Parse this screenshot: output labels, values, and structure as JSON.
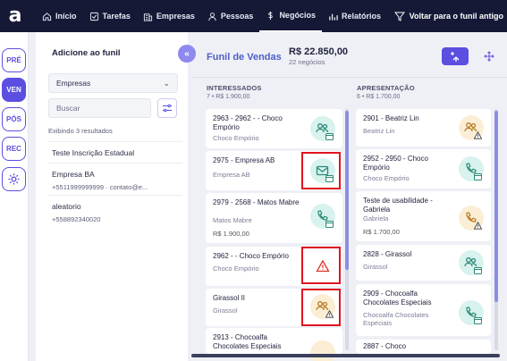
{
  "brand": {
    "logo": "a"
  },
  "nav": {
    "items": [
      {
        "label": "Início",
        "icon": "home-icon"
      },
      {
        "label": "Tarefas",
        "icon": "checkbox-icon"
      },
      {
        "label": "Empresas",
        "icon": "building-icon"
      },
      {
        "label": "Pessoas",
        "icon": "person-icon"
      },
      {
        "label": "Negócios",
        "icon": "money-icon",
        "active": true
      },
      {
        "label": "Relatórios",
        "icon": "chart-icon"
      }
    ],
    "back_label": "Voltar para o funil antigo"
  },
  "rail": {
    "items": [
      "PRÉ",
      "VEN",
      "PÓS",
      "REC"
    ],
    "active": "VEN",
    "settings_icon": "gear-icon"
  },
  "panel": {
    "title": "Adicione ao funil",
    "select_value": "Empresas",
    "search_placeholder": "Buscar",
    "results_text": "Exibindo 3 resultados",
    "entries": [
      {
        "name": "Teste Inscrição Estadual",
        "sub": ""
      },
      {
        "name": "Empresa BA",
        "sub": "+5511999999999 · contato@e..."
      },
      {
        "name": "aleatorio",
        "sub": "+558892340020"
      }
    ]
  },
  "board": {
    "title": "Funil de Vendas",
    "total": "R$ 22.850,00",
    "count": "22 negócios",
    "add_label": "+"
  },
  "columns": [
    {
      "title": "INTERESSADOS",
      "sub": "7 • R$ 1.900,00",
      "cards": [
        {
          "title": "2963 - 2962 - - Choco Empório",
          "company": "Choco Empório",
          "value": "",
          "icon": "people-icon",
          "badge": "green",
          "mini": "calendar-icon"
        },
        {
          "title": "2975 - Empresa AB",
          "company": "Empresa AB",
          "value": "",
          "icon": "email-icon",
          "badge": "green",
          "mini": "calendar-icon"
        },
        {
          "title": "2979 - 2568 - Matos Mabre",
          "company": "Matos Mabre",
          "value": "R$ 1.900,00",
          "icon": "phone-icon",
          "badge": "green",
          "mini": "calendar-icon"
        },
        {
          "title": "2962 - - Choco Empório",
          "company": "Choco Empório",
          "value": "",
          "icon": "warning-icon",
          "badge": "red",
          "mini": ""
        },
        {
          "title": "Girassol II",
          "company": "Girassol",
          "value": "",
          "icon": "people-icon",
          "badge": "orange",
          "mini": "warning-icon"
        },
        {
          "title": "2913 - Chocoalfa Chocolates Especiais",
          "company": "",
          "value": "",
          "icon": "people-icon",
          "badge": "orange",
          "mini": ""
        }
      ]
    },
    {
      "title": "APRESENTAÇÃO",
      "sub": "6 • R$ 1.700,00",
      "cards": [
        {
          "title": "2901 - Beatriz Lin",
          "company": "Beatriz Lin",
          "value": "",
          "icon": "people-icon",
          "badge": "orange",
          "mini": "warning-icon"
        },
        {
          "title": "2952 - 2950 - Choco Empório",
          "company": "Choco Empório",
          "value": "",
          "icon": "phone-icon",
          "badge": "green",
          "mini": "calendar-icon"
        },
        {
          "title": "Teste de usabilidade - Gabriela",
          "company": "Gabriela",
          "value": "R$ 1.700,00",
          "icon": "phone-icon",
          "badge": "orange",
          "mini": "warning-icon"
        },
        {
          "title": "2828 - Girassol",
          "company": "Girassol",
          "value": "",
          "icon": "people-icon",
          "badge": "green",
          "mini": "calendar-icon"
        },
        {
          "title": "2909 - Chocoalfa Chocolates Especiais",
          "company": "Chocoalfa Chocolates Especiais",
          "value": "",
          "icon": "phone-icon",
          "badge": "green",
          "mini": "calendar-icon"
        },
        {
          "title": "2887 - Choco",
          "company": "",
          "value": "",
          "icon": "",
          "badge": "",
          "mini": ""
        }
      ]
    }
  ],
  "colors": {
    "accent": "#5a4fe0",
    "topbar": "#151936",
    "highlight": "#e0141f"
  }
}
